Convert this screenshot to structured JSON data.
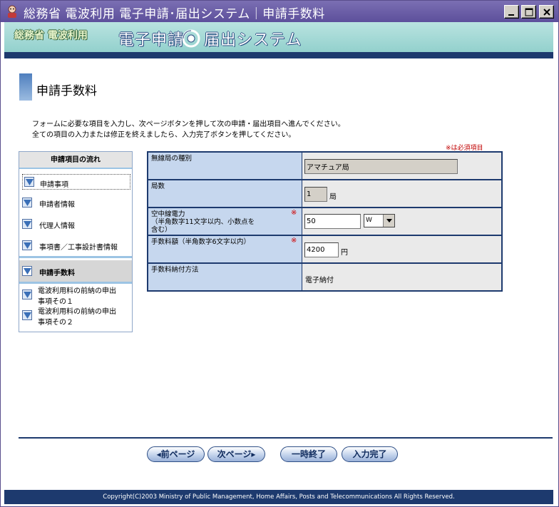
{
  "window": {
    "title": "総務省 電波利用 電子申請･届出システム｜申請手数料",
    "colors": {
      "titlebar": "#5d4f9b",
      "navy": "#1d3a6e",
      "banner": "#a8dcd8",
      "label_cell": "#c6d7ee"
    }
  },
  "banner": {
    "ministry": "総務省 電波利用",
    "system_part1": "電子申請",
    "system_part2": "届出システム"
  },
  "page": {
    "title": "申請手数料",
    "instruction_1": "フォームに必要な項目を入力し、次ページボタンを押して次の申請・届出項目へ進んでください。",
    "instruction_2": "全ての項目の入力または修正を終えましたら、入力完了ボタンを押してください。",
    "required_note": "※は必須項目"
  },
  "sidebar": {
    "heading": "申請項目の流れ",
    "items": [
      {
        "label": "申請事項"
      },
      {
        "label": "申請者情報"
      },
      {
        "label": "代理人情報"
      },
      {
        "label": "事項書／工事設計書情報"
      }
    ],
    "current": "申請手数料",
    "sub_items": [
      {
        "line1": "電波利用料の前納の申出",
        "line2": "事項その１"
      },
      {
        "line1": "電波利用料の前納の申出",
        "line2": "事項その２"
      }
    ]
  },
  "form": {
    "station_type": {
      "label": "無線局の種別",
      "value": "アマチュア局"
    },
    "station_count": {
      "label": "局数",
      "value": "1",
      "unit": "局"
    },
    "antenna_power": {
      "label_line1": "空中線電力",
      "label_line2": "（半角数字11文字以内、小数点を",
      "label_line3": "含む）",
      "required": "※",
      "value": "50",
      "unit_selected": "W"
    },
    "fee": {
      "label": "手数料額（半角数字6文字以内）",
      "required": "※",
      "value": "4200",
      "unit": "円"
    },
    "payment_method": {
      "label": "手数料納付方法",
      "value": "電子納付"
    }
  },
  "buttons": {
    "prev": "◂前ページ",
    "next": "次ページ▸",
    "pause": "一時終了",
    "complete": "入力完了"
  },
  "footer": {
    "copyright": "Copyright(C)2003 Ministry of Public Management, Home Affairs, Posts and Telecommunications All Rights Reserved."
  },
  "icons": [
    "app-icon",
    "minimize-icon",
    "maximize-icon",
    "close-icon",
    "swirl-logo-icon",
    "triangle-down-icon",
    "dropdown-arrow-icon"
  ]
}
